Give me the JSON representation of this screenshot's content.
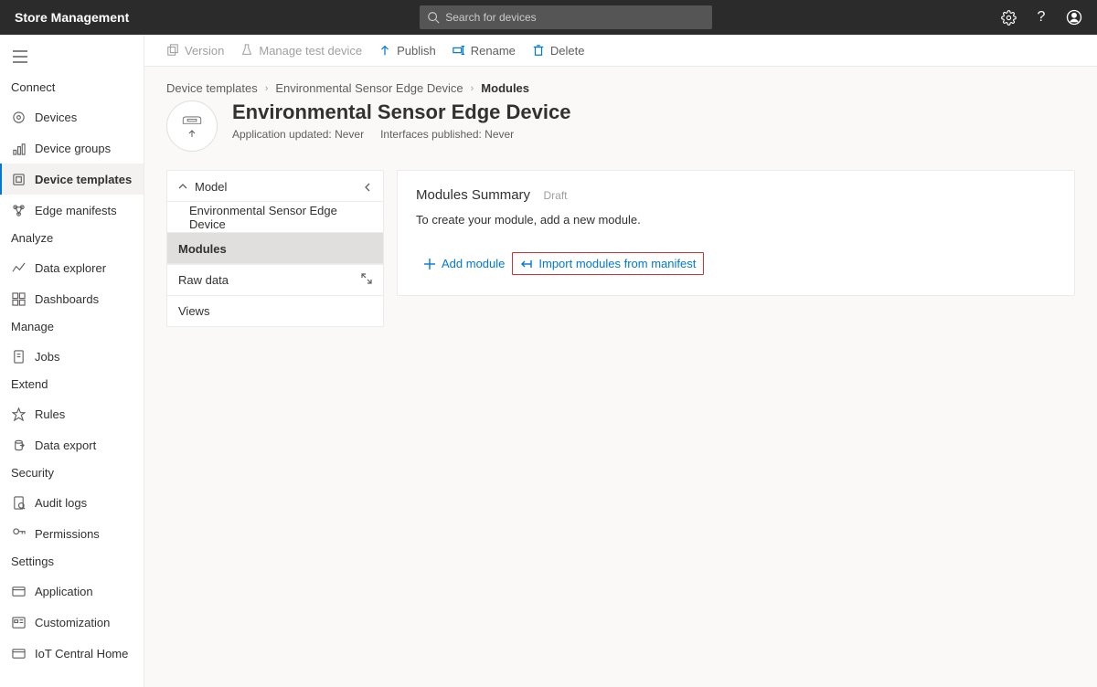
{
  "appTitle": "Store Management",
  "search": {
    "placeholder": "Search for devices"
  },
  "toolbar": {
    "version": "Version",
    "manageTestDevice": "Manage test device",
    "publish": "Publish",
    "rename": "Rename",
    "delete": "Delete"
  },
  "breadcrumb": {
    "root": "Device templates",
    "template": "Environmental Sensor Edge Device",
    "leaf": "Modules"
  },
  "template": {
    "title": "Environmental Sensor Edge Device",
    "meta1": "Application updated: Never",
    "meta2": "Interfaces published: Never"
  },
  "tree": {
    "model": "Model",
    "device": "Environmental Sensor Edge Device",
    "modules": "Modules",
    "rawdata": "Raw data",
    "views": "Views"
  },
  "detail": {
    "title": "Modules Summary",
    "status": "Draft",
    "helper": "To create your module, add a new module.",
    "addModule": "Add module",
    "importManifest": "Import modules from manifest"
  },
  "sidebar": {
    "connect": "Connect",
    "devices": "Devices",
    "deviceGroups": "Device groups",
    "deviceTemplates": "Device templates",
    "edgeManifests": "Edge manifests",
    "analyze": "Analyze",
    "dataExplorer": "Data explorer",
    "dashboards": "Dashboards",
    "manage": "Manage",
    "jobs": "Jobs",
    "extend": "Extend",
    "rules": "Rules",
    "dataExport": "Data export",
    "security": "Security",
    "auditLogs": "Audit logs",
    "permissions": "Permissions",
    "settings": "Settings",
    "application": "Application",
    "customization": "Customization",
    "home": "IoT Central Home"
  }
}
